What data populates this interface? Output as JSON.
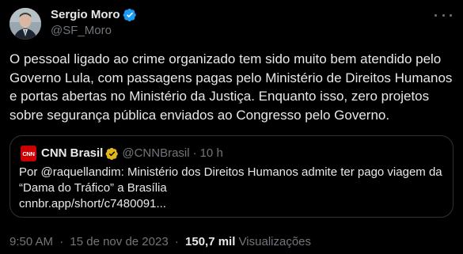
{
  "author": {
    "name": "Sergio Moro",
    "handle": "@SF_Moro"
  },
  "tweet": {
    "text": "O pessoal ligado ao crime organizado tem sido muito bem atendido pelo Governo Lula, com passagens pagas pelo Ministério de Direitos Humanos e portas abertas no Ministério da Justiça. Enquanto isso, zero projetos sobre segurança pública enviados ao Congresso pelo Governo."
  },
  "quote": {
    "avatar_text": "CNN",
    "name": "CNN Brasil",
    "handle": "@CNNBrasil",
    "separator": "·",
    "time": "10 h",
    "text": "Por @raquellandim: Ministério dos Direitos Humanos admite ter pago viagem da “Dama do Tráfico” a Brasília",
    "link": "cnnbr.app/short/c7480091..."
  },
  "meta": {
    "time": "9:50 AM",
    "date": "15 de nov de 2023",
    "separator": "·",
    "views_count": "150,7 mil",
    "views_label": "Visualizações"
  },
  "colors": {
    "background": "#000000",
    "text": "#e7e9ea",
    "muted": "#71767b",
    "verified_blue": "#1d9bf0",
    "verified_gold": "#e2b719",
    "cnn_red": "#cc0000",
    "border": "#2f3336"
  },
  "icons": {
    "verified": "verified-badge-icon",
    "business_verified": "gold-check-icon",
    "more": "more-options-icon"
  }
}
